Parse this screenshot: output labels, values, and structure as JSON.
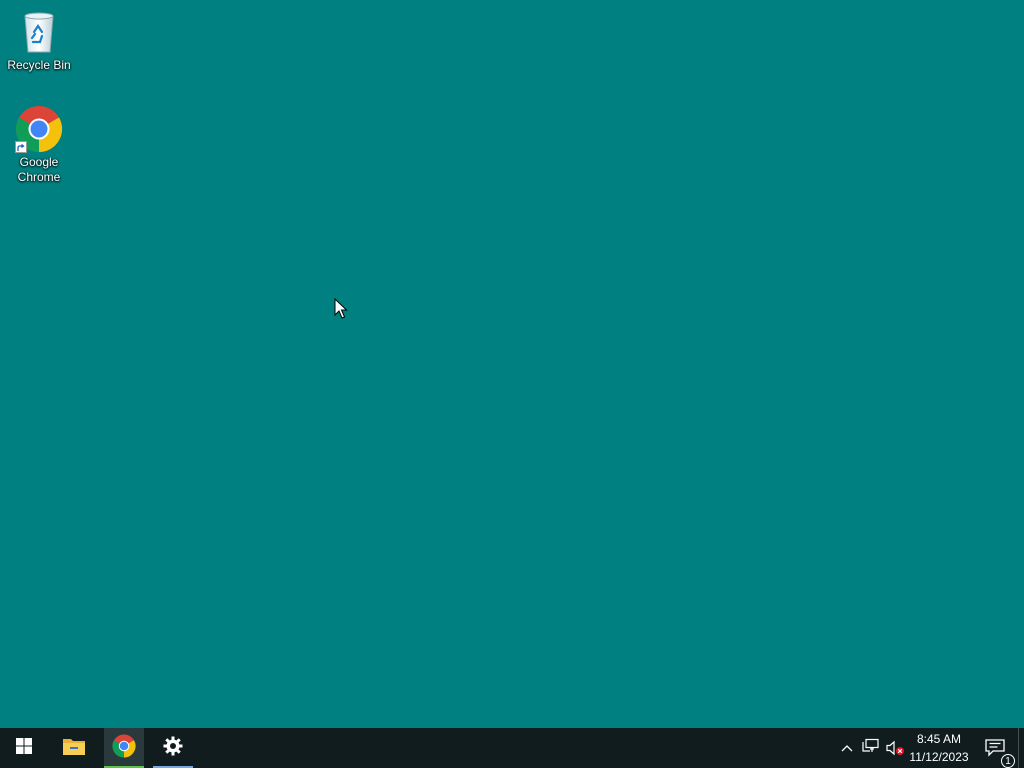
{
  "desktop": {
    "background_color": "#008080",
    "icons": [
      {
        "label": "Recycle Bin",
        "icon": "recycle-bin-icon"
      },
      {
        "label": "Google Chrome",
        "icon": "chrome-icon",
        "shortcut": true
      }
    ]
  },
  "taskbar": {
    "background_color": "#101c1e",
    "buttons": [
      {
        "name": "start",
        "icon": "windows-logo-icon"
      },
      {
        "name": "file-explorer",
        "icon": "folder-icon"
      },
      {
        "name": "google-chrome",
        "icon": "chrome-icon",
        "active": true,
        "indicator_color": "#5ec24a"
      },
      {
        "name": "settings",
        "icon": "gear-icon",
        "indicator_color": "#79a8e0"
      }
    ],
    "tray": {
      "icons": [
        "chevron-up-icon",
        "network-icon",
        "volume-muted-icon"
      ],
      "time": "8:45 AM",
      "date": "11/12/2023",
      "notification_count": "1"
    }
  }
}
